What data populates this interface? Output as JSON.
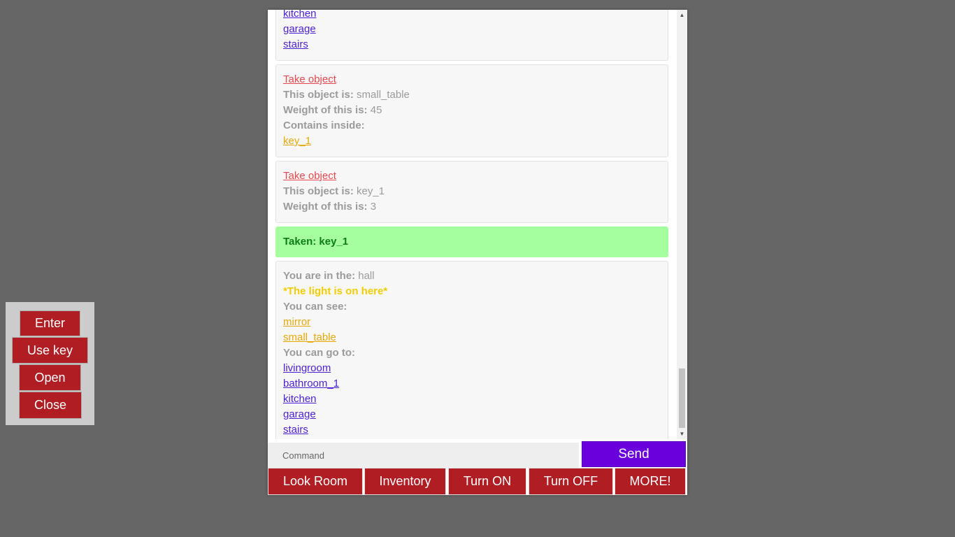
{
  "side_panel": {
    "enter": "Enter",
    "use_key": "Use key",
    "open": "Open",
    "close": "Close"
  },
  "log": {
    "top_exits": [
      "kitchen",
      "garage",
      "stairs"
    ],
    "card_small_table": {
      "take_link": "Take object",
      "object_label": "This object is:",
      "object_value": "small_table",
      "weight_label": "Weight of this is:",
      "weight_value": "45",
      "contains_label": "Contains inside:",
      "contains_item": "key_1"
    },
    "card_key": {
      "take_link": "Take object",
      "object_label": "This object is:",
      "object_value": "key_1",
      "weight_label": "Weight of this is:",
      "weight_value": "3"
    },
    "taken_message": "Taken: key_1",
    "room_card": {
      "room_label": "You are in the:",
      "room_value": "hall",
      "light_message": "*The light is on here*",
      "see_label": "You can see:",
      "objects": [
        "mirror",
        "small_table"
      ],
      "go_label": "You can go to:",
      "exits": [
        "livingroom",
        "bathroom_1",
        "kitchen",
        "garage",
        "stairs"
      ]
    }
  },
  "command": {
    "placeholder": "Command",
    "send_label": "Send"
  },
  "bottom_bar": {
    "look_room": "Look Room",
    "inventory": "Inventory",
    "turn_on": "Turn ON",
    "turn_off": "Turn OFF",
    "more": "MORE!"
  },
  "colors": {
    "background": "#666666",
    "button_red": "#b01e23",
    "send_purple": "#6a00dc",
    "exit_link": "#4b1fd6",
    "object_link": "#e8a80c",
    "take_link": "#e5484d",
    "success_bg": "#a6ff9e",
    "light_text": "#f2cd00"
  }
}
